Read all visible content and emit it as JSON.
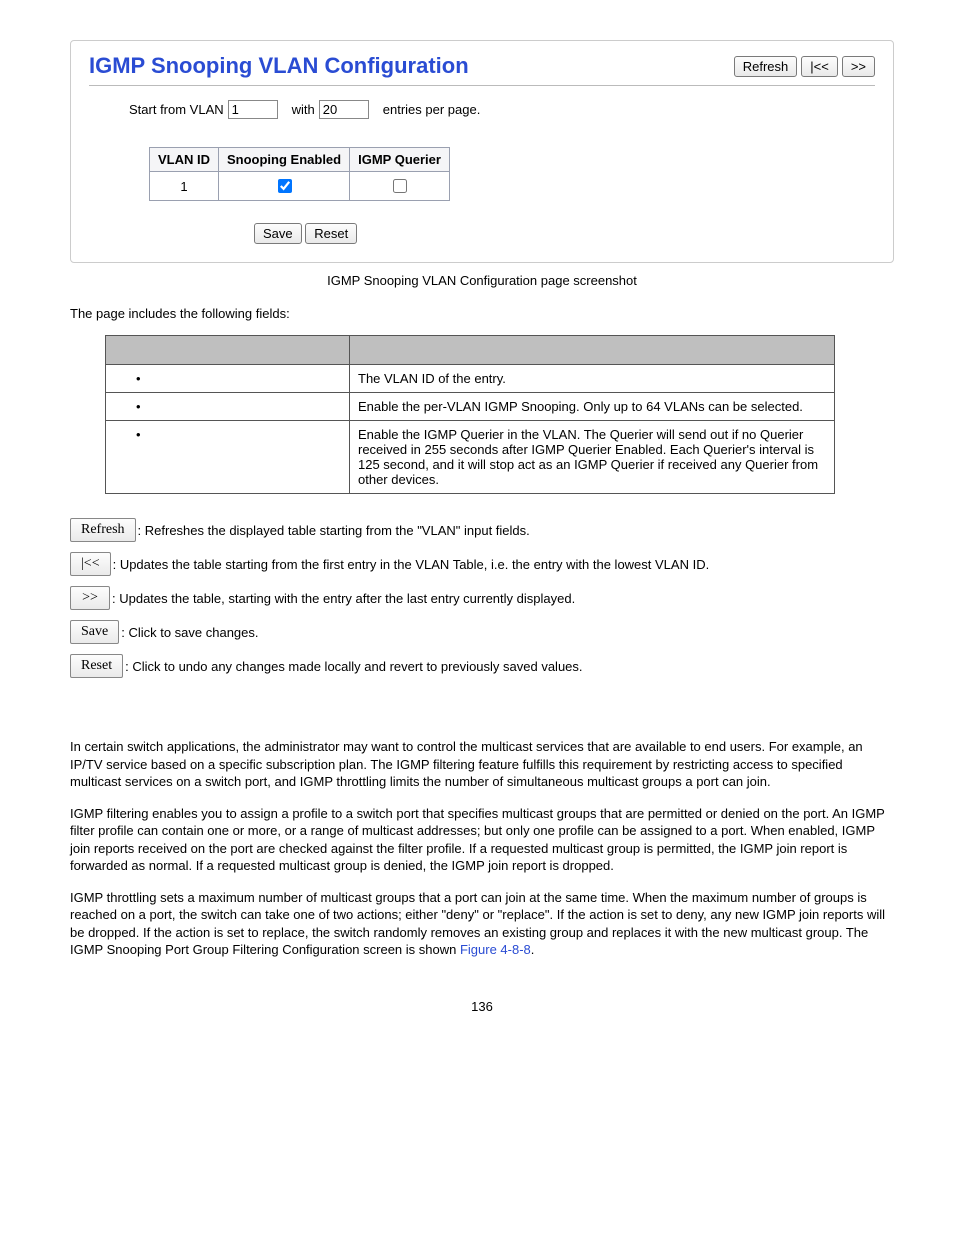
{
  "panel": {
    "title": "IGMP Snooping VLAN Configuration",
    "refresh": "Refresh",
    "first": "|<<",
    "next": ">>",
    "start_label": "Start from VLAN",
    "start_value": "1",
    "with_label": "with",
    "per_page_value": "20",
    "per_page_suffix": "entries per page.",
    "th_vlan": "VLAN ID",
    "th_snoop": "Snooping Enabled",
    "th_querier": "IGMP Querier",
    "row_vlan": "1",
    "save": "Save",
    "reset": "Reset"
  },
  "caption": "IGMP Snooping VLAN Configuration page screenshot",
  "intro": "The page includes the following fields:",
  "fields": [
    {
      "label": "",
      "desc": "The VLAN ID of the entry."
    },
    {
      "label": "",
      "desc": "Enable the per-VLAN IGMP Snooping. Only up to 64 VLANs can be selected."
    },
    {
      "label": "",
      "desc": "Enable the IGMP Querier in the VLAN. The Querier will send out if no Querier received in 255 seconds after IGMP Querier Enabled. Each Querier's interval is 125 second, and it will stop act as an IGMP Querier if received any Querier from other devices."
    }
  ],
  "btns": {
    "refresh": {
      "label": "Refresh",
      "desc": ": Refreshes the displayed table starting from the \"VLAN\" input fields."
    },
    "first": {
      "label": "|<<",
      "desc": ": Updates the table starting from the first entry in the VLAN Table, i.e. the entry with the lowest VLAN ID."
    },
    "next": {
      "label": ">>",
      "desc": ": Updates the table, starting with the entry after the last entry currently displayed."
    },
    "save": {
      "label": "Save",
      "desc": ": Click to save changes."
    },
    "reset": {
      "label": "Reset",
      "desc": ": Click to undo any changes made locally and revert to previously saved values."
    }
  },
  "body": {
    "p1": "In certain switch applications, the administrator may want to control the multicast services that are available to end users. For example, an IP/TV service based on a specific subscription plan. The IGMP filtering feature fulfills this requirement by restricting access to specified multicast services on a switch port, and IGMP throttling limits the number of simultaneous multicast groups a port can join.",
    "p2": "IGMP filtering enables you to assign a profile to a switch port that specifies multicast groups that are permitted or denied on the port. An IGMP filter profile can contain one or more, or a range of multicast addresses; but only one profile can be assigned to a port. When enabled, IGMP join reports received on the port are checked against the filter profile. If a requested multicast group is permitted, the IGMP join report is forwarded as normal. If a requested multicast group is denied, the IGMP join report is dropped.",
    "p3a": "IGMP throttling sets a maximum number of multicast groups that a port can join at the same time. When the maximum number of groups is reached on a port, the switch can take one of two actions; either \"deny\" or \"replace\". If the action is set to deny, any new IGMP join reports will be dropped. If the action is set to replace, the switch randomly removes an existing group and replaces it with the new multicast group. The IGMP Snooping Port Group Filtering Configuration screen is shown ",
    "p3link": "Figure 4-8-8",
    "p3b": "."
  },
  "pagenum": "136"
}
